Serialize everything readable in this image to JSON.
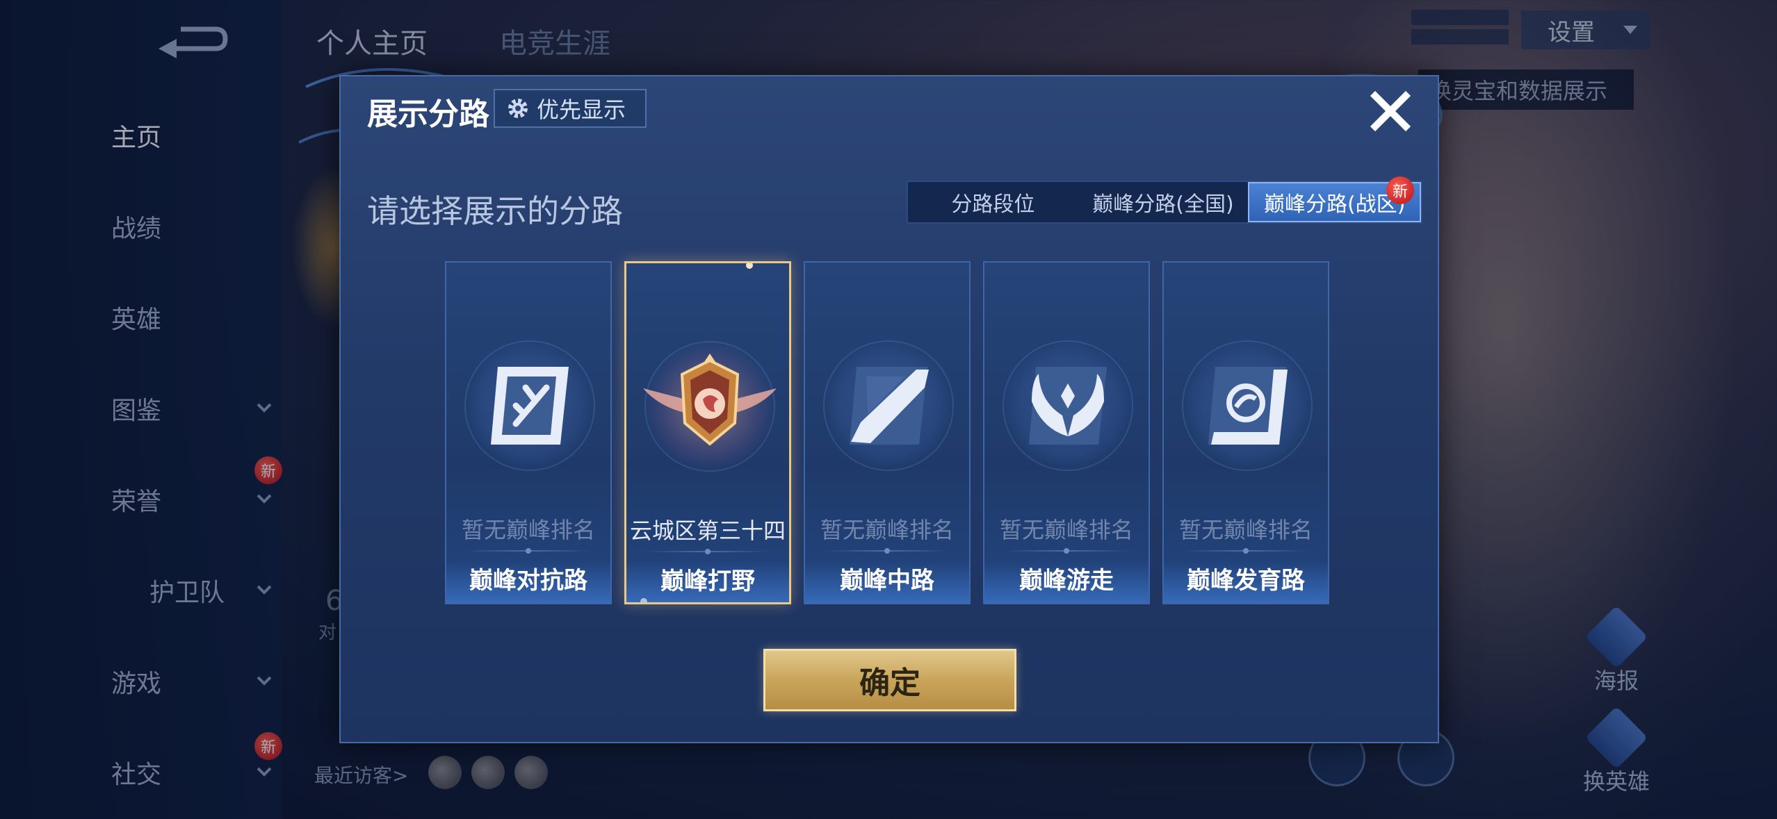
{
  "sidebar": {
    "items": [
      {
        "label": "主页",
        "active": true
      },
      {
        "label": "战绩"
      },
      {
        "label": "英雄"
      },
      {
        "label": "图鉴",
        "chevron": true
      },
      {
        "label": "荣誉",
        "chevron": true,
        "badge": "新"
      },
      {
        "label": "护卫队",
        "chevron": true
      },
      {
        "label": "游戏",
        "chevron": true
      },
      {
        "label": "社交",
        "chevron": true,
        "badge": "新"
      }
    ]
  },
  "header": {
    "tab_personal": "个人主页",
    "tab_esports": "电竞生涯",
    "settings_label": "设置",
    "banner_text": "换灵宝和数据展示"
  },
  "background": {
    "recent_visitors": "最近访客>",
    "poster_label": "海报",
    "change_hero_label": "换英雄",
    "stat_number": "6",
    "stat_sub": "对"
  },
  "dialog": {
    "title": "展示分路",
    "priority_label": "优先显示",
    "subtitle": "请选择展示的分路",
    "segments": [
      {
        "label": "分路段位",
        "active": false
      },
      {
        "label": "巅峰分路(全国)",
        "active": false
      },
      {
        "label": "巅峰分路(战区)",
        "active": true,
        "badge": "新"
      }
    ],
    "cards": [
      {
        "rank": "暂无巅峰排名",
        "lane": "巅峰对抗路",
        "icon": "clash-lane-icon",
        "selected": false
      },
      {
        "rank": "云城区第三十四",
        "lane": "巅峰打野",
        "icon": "jungle-emblem-icon",
        "selected": true
      },
      {
        "rank": "暂无巅峰排名",
        "lane": "巅峰中路",
        "icon": "mid-lane-icon",
        "selected": false
      },
      {
        "rank": "暂无巅峰排名",
        "lane": "巅峰游走",
        "icon": "roam-icon",
        "selected": false
      },
      {
        "rank": "暂无巅峰排名",
        "lane": "巅峰发育路",
        "icon": "farm-lane-icon",
        "selected": false
      }
    ],
    "confirm_label": "确定"
  },
  "colors": {
    "accent_gold": "#e1c78c",
    "selected_border": "#e8c98a",
    "segment_active": "#3a72c8",
    "badge_red": "#d0202a"
  }
}
